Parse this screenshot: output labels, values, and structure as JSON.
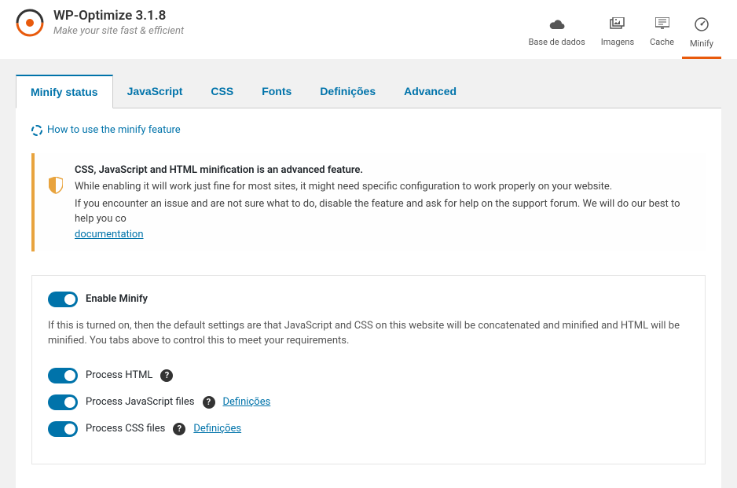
{
  "brand": {
    "title": "WP-Optimize 3.1.8",
    "tagline": "Make your site fast & efficient"
  },
  "nav": [
    {
      "label": "Base de dados",
      "icon": "cloud"
    },
    {
      "label": "Imagens",
      "icon": "images"
    },
    {
      "label": "Cache",
      "icon": "cache"
    },
    {
      "label": "Minify",
      "icon": "gauge",
      "active": true
    }
  ],
  "tabs": [
    {
      "label": "Minify status",
      "active": true
    },
    {
      "label": "JavaScript"
    },
    {
      "label": "CSS"
    },
    {
      "label": "Fonts"
    },
    {
      "label": "Definições"
    },
    {
      "label": "Advanced"
    }
  ],
  "help_link": "How to use the minify feature",
  "warning": {
    "title": "CSS, JavaScript and HTML minification is an advanced feature.",
    "line1": "While enabling it will work just fine for most sites, it might need specific configuration to work properly on your website.",
    "line2_prefix": "If you encounter an issue and are not sure what to do, disable the feature and ask for help on the support forum. We will do our best to help you co",
    "doc_link": "documentation"
  },
  "enable": {
    "label": "Enable Minify",
    "description": "If this is turned on, then the default settings are that JavaScript and CSS on this website will be concatenated and minified and HTML will be minified. You tabs above to control this to meet your requirements."
  },
  "options": [
    {
      "label": "Process HTML",
      "help": true
    },
    {
      "label": "Process JavaScript files",
      "help": true,
      "def": "Definições"
    },
    {
      "label": "Process CSS files",
      "help": true,
      "def": "Definições"
    }
  ]
}
